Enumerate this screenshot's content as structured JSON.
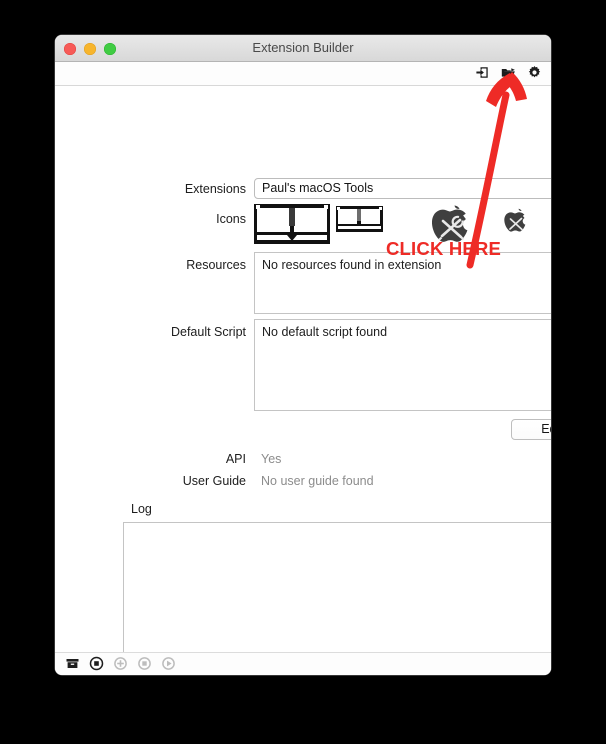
{
  "window": {
    "title": "Extension Builder",
    "traffic_lights": [
      {
        "name": "close",
        "color": "#f75a57"
      },
      {
        "name": "minimize",
        "color": "#f7b52d"
      },
      {
        "name": "zoom",
        "color": "#40cc43"
      }
    ]
  },
  "toolbar": {
    "icons": [
      {
        "name": "export-icon",
        "label": "Export Extension"
      },
      {
        "name": "open-folder-icon",
        "label": "Open Folder"
      },
      {
        "name": "gear-icon",
        "label": "Settings"
      }
    ]
  },
  "form": {
    "extensions": {
      "label": "Extensions",
      "value": "Paul's macOS Tools",
      "stepper": "up-down-stepper"
    },
    "icons": {
      "label": "Icons",
      "items": [
        {
          "name": "book-icon-large"
        },
        {
          "name": "book-icon-small"
        },
        {
          "name": "apple-tools-icon-large"
        },
        {
          "name": "apple-tools-icon-small"
        }
      ]
    },
    "resources": {
      "label": "Resources",
      "value": "No resources found in extension"
    },
    "default_script": {
      "label": "Default Script",
      "value": "No default script found"
    },
    "edit_button": "Edit",
    "api": {
      "label": "API",
      "value": "Yes"
    },
    "user_guide": {
      "label": "User Guide",
      "value": "No user guide found"
    },
    "log": {
      "label": "Log",
      "value": ""
    }
  },
  "bottom_bar": {
    "icons": [
      {
        "name": "archive-icon",
        "enabled": true
      },
      {
        "name": "record-stop-icon",
        "enabled": true
      },
      {
        "name": "add-circle-icon",
        "enabled": false
      },
      {
        "name": "stop-circle-icon",
        "enabled": false
      },
      {
        "name": "play-circle-icon",
        "enabled": false
      }
    ]
  },
  "annotation": {
    "text": "CLICK HERE",
    "color": "#ee2b26",
    "arrow": "curved-arrow-pointing-to-open-folder-icon"
  }
}
